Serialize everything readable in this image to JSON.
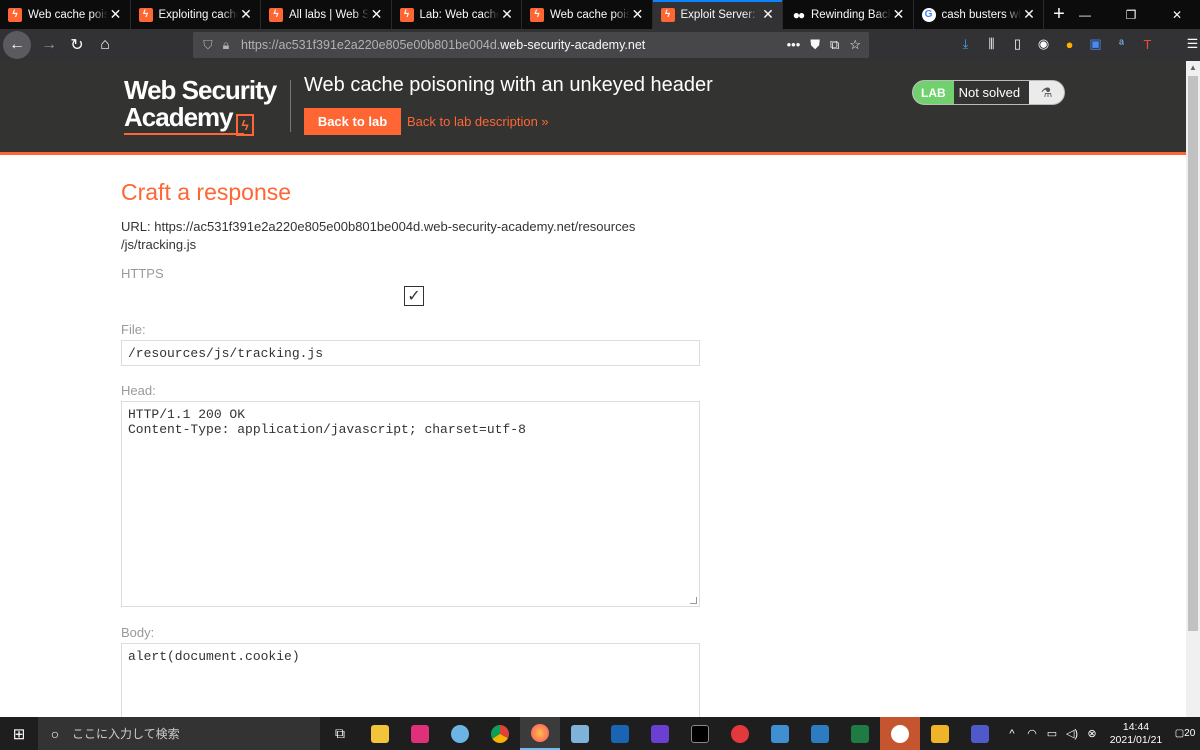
{
  "browser": {
    "tabs": [
      {
        "title": "Web cache poisoni",
        "icon": "portswigger-icon",
        "active": false
      },
      {
        "title": "Exploiting cache d",
        "icon": "portswigger-icon",
        "active": false
      },
      {
        "title": "All labs | Web Sec",
        "icon": "portswigger-icon",
        "active": false
      },
      {
        "title": "Lab: Web cache po",
        "icon": "portswigger-icon",
        "active": false
      },
      {
        "title": "Web cache poisoni",
        "icon": "portswigger-icon",
        "active": false
      },
      {
        "title": "Exploit Server: We",
        "icon": "portswigger-icon",
        "active": true
      },
      {
        "title": "Rewinding Back to",
        "icon": "medium-icon",
        "active": false
      },
      {
        "title": "cash busters what",
        "icon": "google-icon",
        "active": false
      }
    ],
    "url_prefix": "https://ac531f391e2a220e805e00b801be004d.",
    "url_domain": "web-security-academy.net"
  },
  "header": {
    "logo_line1": "Web Security",
    "logo_line2": "Academy",
    "lab_title": "Web cache poisoning with an unkeyed header",
    "back_button": "Back to lab",
    "description_link": "Back to lab description",
    "lab_tag": "LAB",
    "lab_status": "Not solved"
  },
  "form": {
    "heading": "Craft a response",
    "url_line1": "URL: https://ac531f391e2a220e805e00b801be004d.web-security-academy.net/resources",
    "url_line2": "/js/tracking.js",
    "https_label": "HTTPS",
    "https_checked": true,
    "file_label": "File:",
    "file_value": "/resources/js/tracking.js",
    "head_label": "Head:",
    "head_value": "HTTP/1.1 200 OK\nContent-Type: application/javascript; charset=utf-8",
    "body_label": "Body:",
    "body_value": "alert(document.cookie)"
  },
  "taskbar": {
    "search_placeholder": "ここに入力して検索",
    "time": "14:44",
    "date": "2021/01/21",
    "notification_count": "20"
  }
}
